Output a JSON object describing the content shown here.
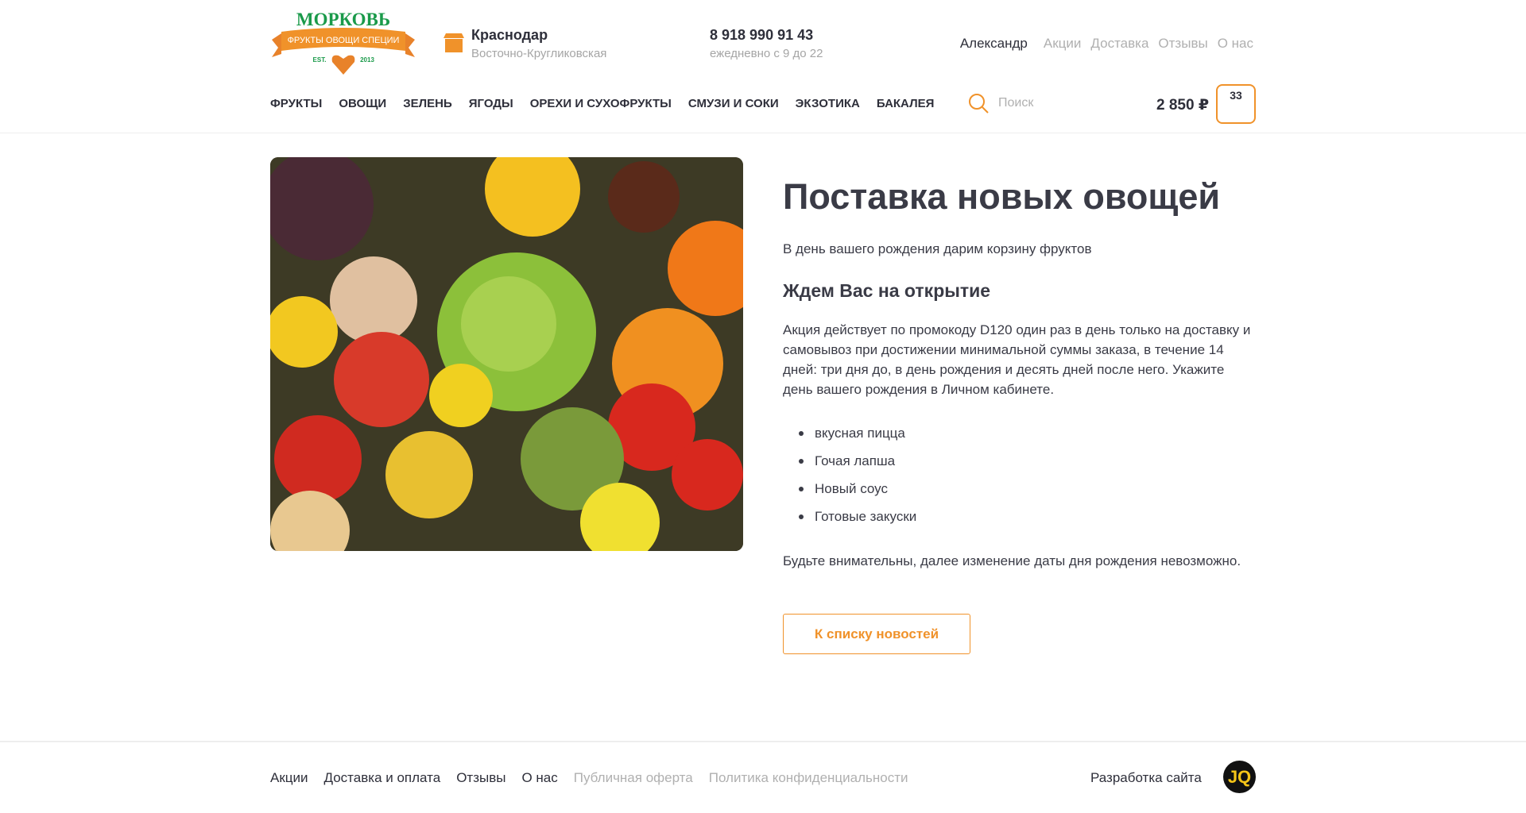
{
  "header": {
    "logo_text": "МОРКОВЬ",
    "logo_ribbon": "ФРУКТЫ ОВОЩИ СПЕЦИИ",
    "logo_est": "EST.",
    "logo_year": "2013",
    "city": "Краснодар",
    "street": "Восточно-Кругликовская",
    "phone": "8 918 990 91 43",
    "hours": "ежедневно с 9 до 22",
    "user": "Александр",
    "links": [
      "Акции",
      "Доставка",
      "Отзывы",
      "О нас"
    ],
    "nav": [
      "ФРУКТЫ",
      "ОВОЩИ",
      "ЗЕЛЕНЬ",
      "ЯГОДЫ",
      "ОРЕХИ И СУХОФРУКТЫ",
      "СМУЗИ И СОКИ",
      "ЭКЗОТИКА",
      "БАКАЛЕЯ"
    ],
    "search_placeholder": "Поиск",
    "cart_total": "2 850 ₽",
    "cart_count": "33"
  },
  "article": {
    "title": "Поставка новых овощей",
    "lead": "В день вашего рождения дарим корзину фруктов",
    "subtitle": "Ждем Вас на открытие",
    "body": "Акция действует по промокоду D120 один раз в день только на доставку и самовывоз при достижении минимальной суммы заказа, в течение 14 дней: три дня до, в день рождения и десять дней после него. Укажите день вашего рождения в Личном кабинете.",
    "list": [
      "вкусная пицца",
      "Гочая лапша",
      "Новый соус",
      "Готовые закуски"
    ],
    "note": "Будьте внимательны, далее изменение даты дня рождения невозможно.",
    "back_button": "К списку новостей"
  },
  "footer": {
    "links": [
      "Акции",
      "Доставка и оплата",
      "Отзывы",
      "О нас"
    ],
    "muted_links": [
      "Публичная оферта",
      "Политика конфиденциальности"
    ],
    "dev": "Разработка сайта",
    "dev_logo": "JQ"
  },
  "colors": {
    "accent": "#f0922a",
    "green": "#1a9a4a"
  }
}
